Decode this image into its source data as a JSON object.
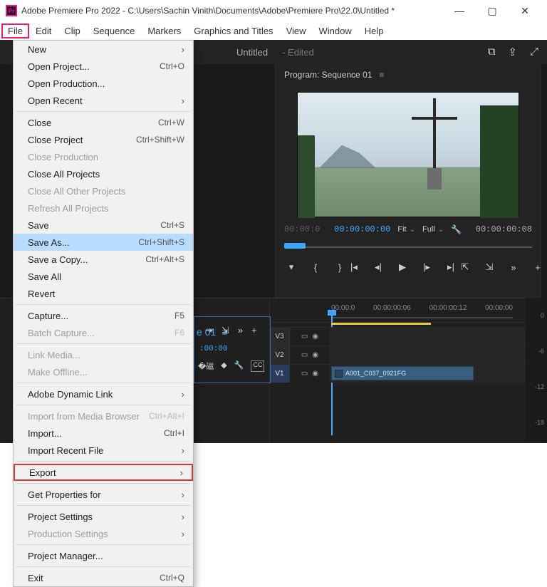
{
  "title": "Adobe Premiere Pro 2022 - C:\\Users\\Sachin Vinith\\Documents\\Adobe\\Premiere Pro\\22.0\\Untitled *",
  "app_icon_label": "Pr",
  "menus": [
    "File",
    "Edit",
    "Clip",
    "Sequence",
    "Markers",
    "Graphics and Titles",
    "View",
    "Window",
    "Help"
  ],
  "topbar": {
    "tab": "Untitled",
    "state": "- Edited"
  },
  "program": {
    "title": "Program: Sequence 01",
    "tc_left": "00:00:0",
    "tc_current": "00:00:00:00",
    "fit": "Fit",
    "full": "Full",
    "tc_right": "00:00:00:08"
  },
  "timeline": {
    "ticks": [
      "00:00:0",
      "00:00:00:06",
      "00:00:00:12",
      "00:00:00"
    ],
    "tracks": [
      "V3",
      "V2",
      "V1"
    ],
    "clip": "A001_C037_0921FG"
  },
  "ruler": [
    "0",
    "-6",
    "-12",
    "-18"
  ],
  "source": {
    "tab": "e 01",
    "tc": ":00:00"
  },
  "file_menu": [
    {
      "label": "New",
      "sc": "",
      "sub": true
    },
    {
      "label": "Open Project...",
      "sc": "Ctrl+O"
    },
    {
      "label": "Open Production..."
    },
    {
      "label": "Open Recent",
      "sub": true
    },
    {
      "sep": true
    },
    {
      "label": "Close",
      "sc": "Ctrl+W"
    },
    {
      "label": "Close Project",
      "sc": "Ctrl+Shift+W"
    },
    {
      "label": "Close Production",
      "disabled": true
    },
    {
      "label": "Close All Projects"
    },
    {
      "label": "Close All Other Projects",
      "disabled": true
    },
    {
      "label": "Refresh All Projects",
      "disabled": true
    },
    {
      "label": "Save",
      "sc": "Ctrl+S"
    },
    {
      "label": "Save As...",
      "sc": "Ctrl+Shift+S",
      "hl": true
    },
    {
      "label": "Save a Copy...",
      "sc": "Ctrl+Alt+S"
    },
    {
      "label": "Save All"
    },
    {
      "label": "Revert"
    },
    {
      "sep": true
    },
    {
      "label": "Capture...",
      "sc": "F5"
    },
    {
      "label": "Batch Capture...",
      "sc": "F6",
      "disabled": true
    },
    {
      "sep": true
    },
    {
      "label": "Link Media...",
      "disabled": true
    },
    {
      "label": "Make Offline...",
      "disabled": true
    },
    {
      "sep": true
    },
    {
      "label": "Adobe Dynamic Link",
      "sub": true
    },
    {
      "sep": true
    },
    {
      "label": "Import from Media Browser",
      "sc": "Ctrl+Alt+I",
      "disabled": true
    },
    {
      "label": "Import...",
      "sc": "Ctrl+I"
    },
    {
      "label": "Import Recent File",
      "sub": true
    },
    {
      "sep": true
    },
    {
      "label": "Export",
      "sub": true,
      "boxed": true
    },
    {
      "sep": true
    },
    {
      "label": "Get Properties for",
      "sub": true
    },
    {
      "sep": true
    },
    {
      "label": "Project Settings",
      "sub": true
    },
    {
      "label": "Production Settings",
      "sub": true,
      "disabled": true
    },
    {
      "sep": true
    },
    {
      "label": "Project Manager..."
    },
    {
      "sep": true
    },
    {
      "label": "Exit",
      "sc": "Ctrl+Q"
    }
  ]
}
